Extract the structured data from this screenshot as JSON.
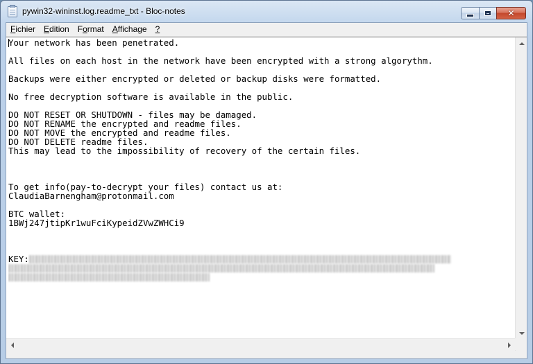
{
  "window": {
    "title": "pywin32-wininst.log.readme_txt - Bloc-notes",
    "close_glyph": "✕"
  },
  "menu": [
    {
      "label_u": "F",
      "label_rest": "ichier"
    },
    {
      "label_u": "E",
      "label_rest": "dition"
    },
    {
      "label_pre": "F",
      "label_u": "o",
      "label_rest": "rmat"
    },
    {
      "label_u": "A",
      "label_rest": "ffichage"
    },
    {
      "label_u": "?",
      "label_rest": ""
    }
  ],
  "document": {
    "lines": [
      "Your network has been penetrated.",
      "",
      "All files on each host in the network have been encrypted with a strong algorythm.",
      "",
      "Backups were either encrypted or deleted or backup disks were formatted.",
      "",
      "No free decryption software is available in the public.",
      "",
      "DO NOT RESET OR SHUTDOWN - files may be damaged.",
      "DO NOT RENAME the encrypted and readme files.",
      "DO NOT MOVE the encrypted and readme files.",
      "DO NOT DELETE readme files.",
      "This may lead to the impossibility of recovery of the certain files.",
      "",
      "",
      "",
      "To get info(pay-to-decrypt your files) contact us at:",
      "ClaudiaBarnengham@protonmail.com",
      "",
      "BTC wallet:",
      "1BWj247jtipKr1wuFciKypeidZVwZWHCi9",
      "",
      "",
      "",
      "KEY:"
    ],
    "key_redacted": true
  },
  "colors": {
    "title_bar": "#c6d9ee",
    "close_button": "#c4482d",
    "editor_bg": "#ffffff"
  },
  "icons": {
    "app": "notepad-icon",
    "minimize": "minimize-icon",
    "maximize": "maximize-icon",
    "close": "close-icon"
  }
}
